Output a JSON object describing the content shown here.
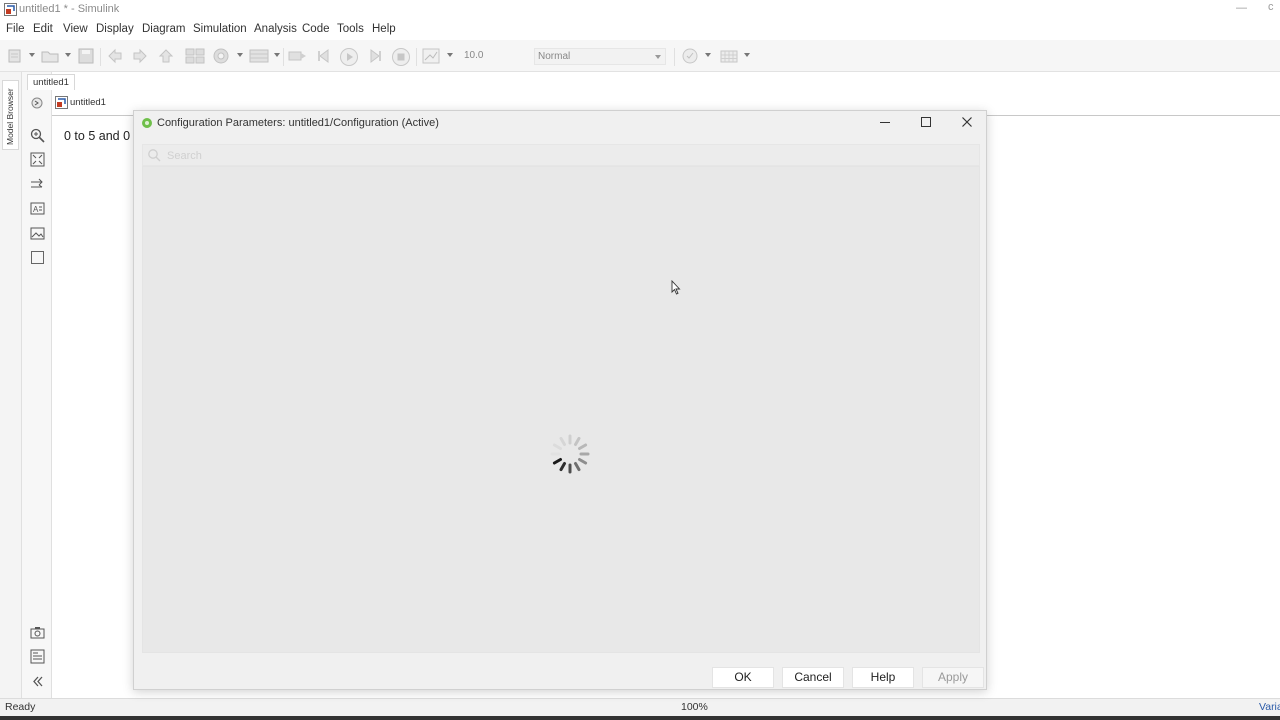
{
  "window": {
    "title": "untitled1 * - Simulink",
    "minimize_glyph": "—",
    "close_glyph": "c"
  },
  "menu": {
    "items": [
      "File",
      "Edit",
      "View",
      "Display",
      "Diagram",
      "Simulation",
      "Analysis",
      "Code",
      "Tools",
      "Help"
    ]
  },
  "toolbar": {
    "stop_time": "10.0",
    "simulation_mode": "Normal",
    "icons": [
      "new-model-icon",
      "open-icon",
      "save-icon",
      "back-icon",
      "forward-icon",
      "up-icon",
      "library-browser-icon",
      "model-config-icon",
      "model-explorer-icon",
      "step-back-icon",
      "run-icon",
      "step-forward-icon",
      "stop-icon",
      "record-icon",
      "debug-icon",
      "grid-icon"
    ]
  },
  "left_panel": {
    "model_browser_label": "Model Browser"
  },
  "editor": {
    "tab_label": "untitled1",
    "breadcrumb": "untitled1",
    "annotation_text": "0 to 5 and 0"
  },
  "dialog": {
    "title": "Configuration Parameters: untitled1/Configuration (Active)",
    "search_placeholder": "Search",
    "state": "loading",
    "buttons": {
      "ok": "OK",
      "cancel": "Cancel",
      "help": "Help",
      "apply": "Apply"
    },
    "apply_enabled": false
  },
  "status": {
    "left": "Ready",
    "zoom": "100%",
    "right": "VariableStepAuto"
  },
  "colors": {
    "dialog_bg": "#f0f0f0",
    "content_bg": "#e8e8e8",
    "link_blue": "#2a5aa8",
    "dialog_icon_green": "#6fbf4a"
  }
}
